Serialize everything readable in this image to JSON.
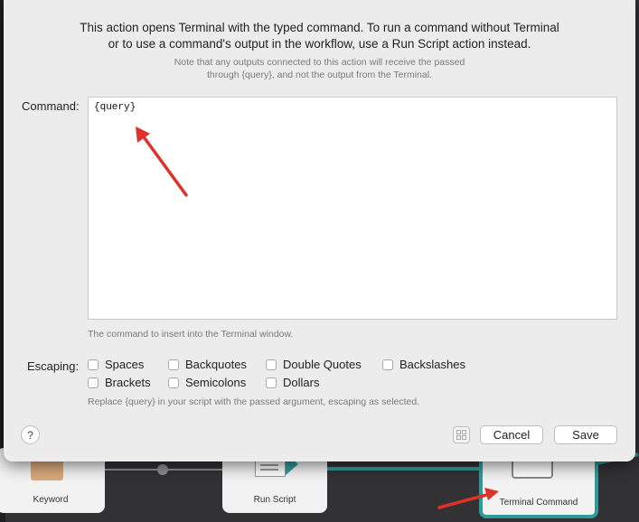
{
  "dialog": {
    "intro_line1": "This action opens Terminal with the typed command. To run a command without Terminal",
    "intro_line2": "or to use a command's output in the workflow, use a Run Script action instead.",
    "note_line1": "Note that any outputs connected to this action will receive the passed",
    "note_line2": "through {query}, and not the output from the Terminal.",
    "command_label": "Command:",
    "command_value": "{query}",
    "command_hint": "The command to insert into the Terminal window.",
    "escaping_label": "Escaping:",
    "escaping_options": [
      {
        "label": "Spaces",
        "checked": false
      },
      {
        "label": "Backquotes",
        "checked": false
      },
      {
        "label": "Double Quotes",
        "checked": false
      },
      {
        "label": "Backslashes",
        "checked": false
      },
      {
        "label": "Brackets",
        "checked": false
      },
      {
        "label": "Semicolons",
        "checked": false
      },
      {
        "label": "Dollars",
        "checked": false
      }
    ],
    "escaping_hint": "Replace {query} in your script with the passed argument, escaping as selected.",
    "help_label": "?",
    "cancel_label": "Cancel",
    "save_label": "Save"
  },
  "workflow": {
    "nodes": [
      {
        "label": "Keyword",
        "icon": "avatar-icon"
      },
      {
        "label": "Run Script",
        "icon": "script-icon"
      },
      {
        "label": "Terminal Command",
        "icon": "terminal-icon",
        "selected": true
      }
    ]
  },
  "colors": {
    "accent_teal": "#2f9a9a",
    "annotation_red": "#e0302a",
    "sheet_bg": "#ececec"
  }
}
